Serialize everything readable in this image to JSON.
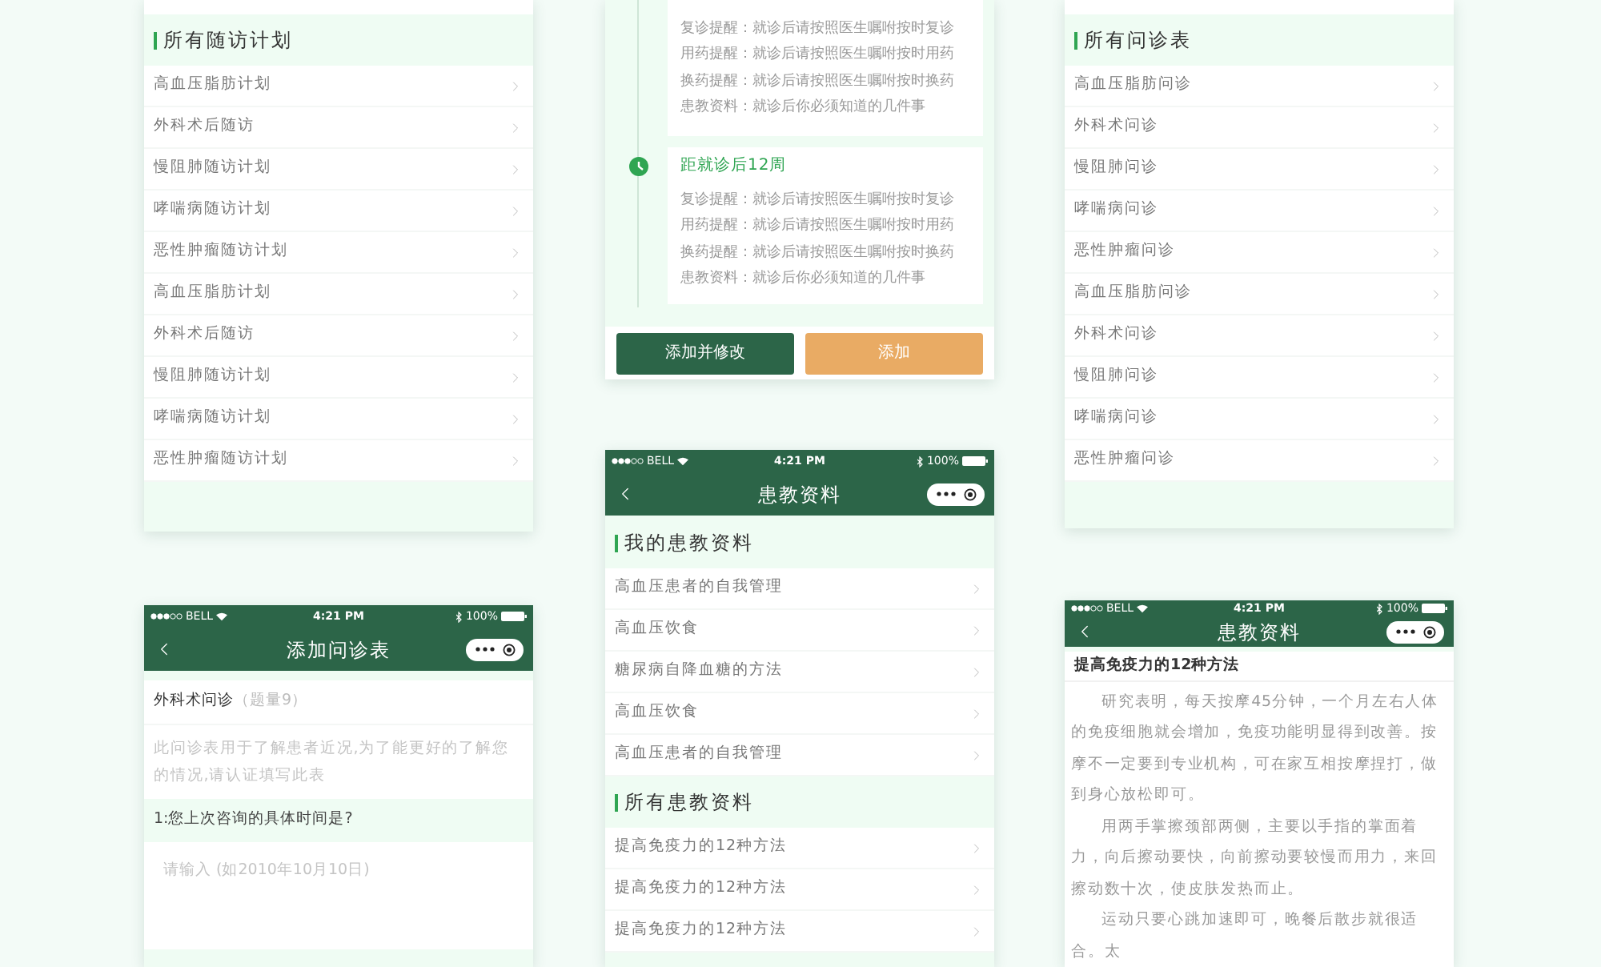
{
  "screens": [
    {
      "kind": "list",
      "sections": [
        {
          "title": "所有随访计划",
          "items": [
            "高血压脂肪计划",
            "外科术后随访",
            "慢阻肺随访计划",
            "哮喘病随访计划",
            "恶性肿瘤随访计划",
            "高血压脂肪计划",
            "外科术后随访",
            "慢阻肺随访计划",
            "哮喘病随访计划",
            "恶性肿瘤随访计划"
          ]
        }
      ]
    },
    {
      "kind": "timeline",
      "entries": [
        {
          "lines": [
            "复诊提醒：就诊后请按照医生嘱咐按时复诊",
            "用药提醒：就诊后请按照医生嘱咐按时用药",
            "换药提醒：就诊后请按照医生嘱咐按时换药",
            "患教资料：就诊后你必须知道的几件事"
          ]
        },
        {
          "title": "距就诊后12周",
          "lines": [
            "复诊提醒：就诊后请按照医生嘱咐按时复诊",
            "用药提醒：就诊后请按照医生嘱咐按时用药",
            "换药提醒：就诊后请按照医生嘱咐按时换药",
            "患教资料：就诊后你必须知道的几件事"
          ]
        }
      ],
      "buttons": [
        {
          "label": "添加并修改",
          "kind": "primary"
        },
        {
          "label": "添加",
          "kind": "secondary"
        }
      ]
    },
    {
      "kind": "list",
      "sections": [
        {
          "title": "所有问诊表",
          "items": [
            "高血压脂肪问诊",
            "外科术问诊",
            "慢阻肺问诊",
            "哮喘病问诊",
            "恶性肿瘤问诊",
            "高血压脂肪问诊",
            "外科术问诊",
            "慢阻肺问诊",
            "哮喘病问诊",
            "恶性肿瘤问诊"
          ]
        }
      ]
    },
    {
      "kind": "form",
      "status_bar": {
        "carrier": "BELL",
        "time": "4:21 PM",
        "battery": "100%"
      },
      "title": "添加问诊表",
      "form_title": "外科术问诊",
      "count": "（题量9）",
      "description": "此问诊表用于了解患者近况,为了能更好的了解您的情况,请认证填写此表",
      "questions": [
        {
          "label": "1:您上次咨询的具体时间是?",
          "placeholder": "请输入 (如2010年10月10日)"
        }
      ]
    },
    {
      "kind": "list",
      "status_bar": {
        "carrier": "BELL",
        "time": "4:21 PM",
        "battery": "100%"
      },
      "title": "患教资料",
      "sections": [
        {
          "title": "我的患教资料",
          "items": [
            "高血压患者的自我管理",
            "高血压饮食",
            "糖尿病自降血糖的方法",
            "高血压饮食",
            "高血压患者的自我管理"
          ]
        },
        {
          "title": "所有患教资料",
          "items": [
            "提高免疫力的12种方法",
            "提高免疫力的12种方法",
            "提高免疫力的12种方法"
          ]
        }
      ]
    },
    {
      "kind": "article",
      "status_bar": {
        "carrier": "BELL",
        "time": "4:21 PM",
        "battery": "100%"
      },
      "title": "患教资料",
      "article_title": "提高免疫力的12种方法",
      "paragraphs": [
        "研究表明，每天按摩45分钟，一个月左右人体的免疫细胞就会增加，免疫功能明显得到改善。按摩不一定要到专业机构，可在家互相按摩捏打，做到身心放松即可。",
        "用两手掌擦颈部两侧，主要以手指的掌面着力，向后擦动要快，向前擦动要较慢而用力，来回擦动数十次，使皮肤发热而止。",
        "运动只要心跳加速即可，晚餐后散步就很适合。太"
      ]
    }
  ]
}
